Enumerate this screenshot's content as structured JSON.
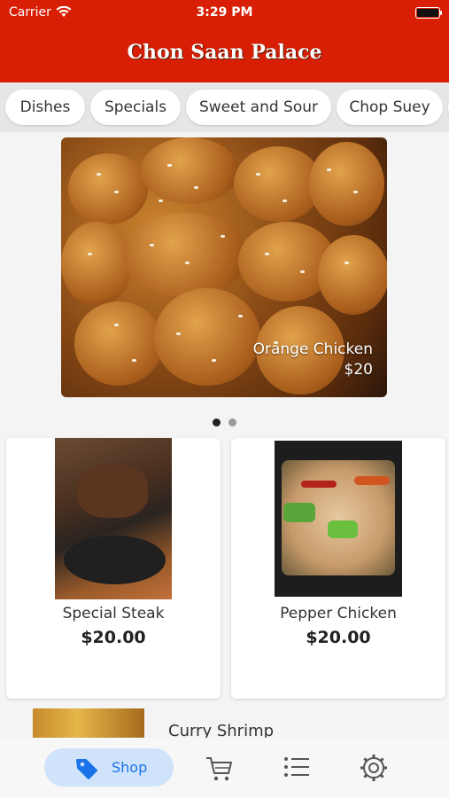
{
  "status_bar": {
    "carrier": "Carrier",
    "time": "3:29 PM"
  },
  "header": {
    "title": "Chon Saan Palace"
  },
  "categories": [
    "Dishes",
    "Specials",
    "Sweet and Sour",
    "Chop Suey"
  ],
  "hero": {
    "name": "Orange Chicken",
    "price": "$20",
    "page_count": 2,
    "active_page": 1
  },
  "cards": [
    {
      "name": "Special Steak",
      "price": "$20.00"
    },
    {
      "name": "Pepper Chicken",
      "price": "$20.00"
    }
  ],
  "list": [
    {
      "name": "Curry Shrimp"
    }
  ],
  "tabbar": {
    "shop_label": "Shop",
    "icons": [
      "tag-icon",
      "cart-icon",
      "list-icon",
      "settings-icon"
    ],
    "active_color": "#1a73e8",
    "active_bg": "#cfe3fa"
  },
  "colors": {
    "header": "#d81f06"
  }
}
